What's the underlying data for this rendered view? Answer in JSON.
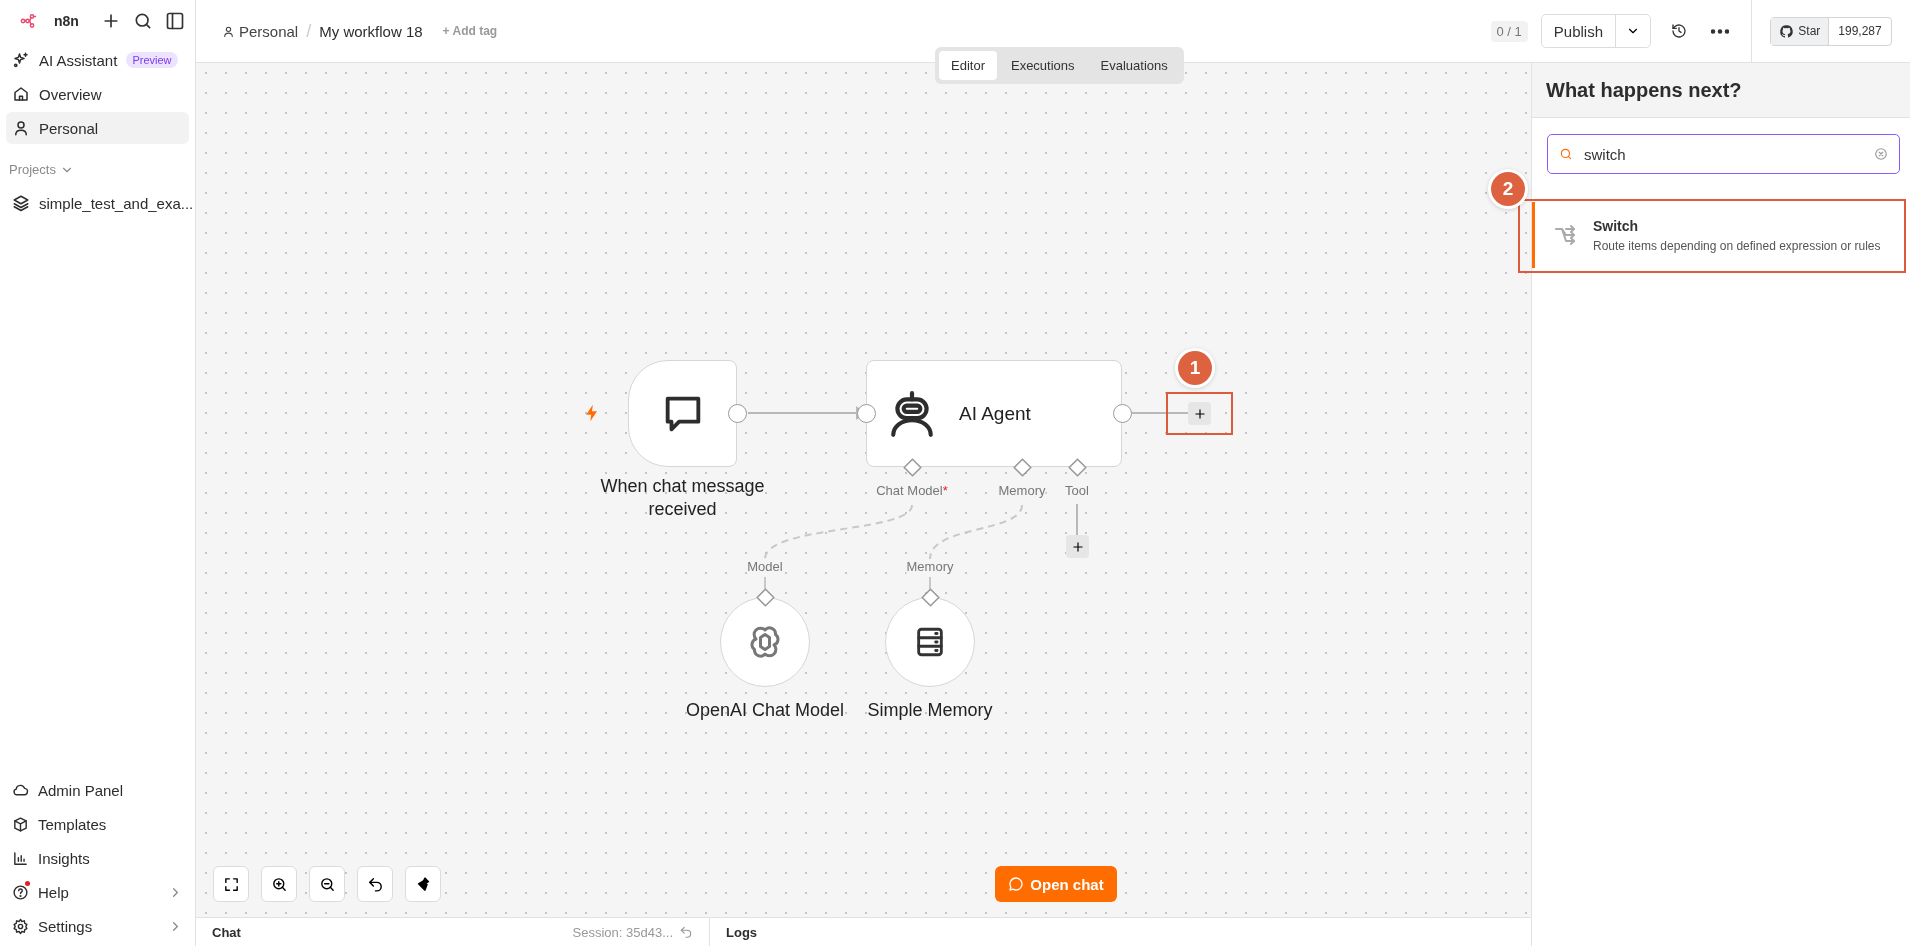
{
  "sidebar": {
    "logo": "n8n",
    "items": [
      {
        "label": "AI Assistant",
        "badge": "Preview",
        "selected": false
      },
      {
        "label": "Overview",
        "selected": false
      },
      {
        "label": "Personal",
        "selected": true
      }
    ],
    "projects_heading": "Projects",
    "projects": [
      {
        "label": "simple_test_and_exa..."
      }
    ],
    "bottom_items": [
      {
        "label": "Admin Panel",
        "notification": false,
        "submenu": false
      },
      {
        "label": "Templates",
        "notification": false,
        "submenu": false
      },
      {
        "label": "Insights",
        "notification": false,
        "submenu": false
      },
      {
        "label": "Help",
        "notification": true,
        "submenu": true
      },
      {
        "label": "Settings",
        "notification": false,
        "submenu": true
      }
    ]
  },
  "header": {
    "project": "Personal",
    "separator": "/",
    "workflow_name": "My workflow 18",
    "add_tag": "+ Add tag",
    "counter": "0 / 1",
    "publish": "Publish",
    "github_star": "Star",
    "github_count": "199,287"
  },
  "view_tabs": [
    {
      "label": "Editor",
      "selected": true
    },
    {
      "label": "Executions",
      "selected": false
    },
    {
      "label": "Evaluations",
      "selected": false
    }
  ],
  "canvas": {
    "nodes": [
      {
        "kind": "trigger",
        "name": "When chat message received"
      },
      {
        "kind": "agent",
        "name": "AI Agent",
        "inputs": [
          {
            "label": "Chat Model",
            "mark": "*"
          },
          {
            "label": "Memory"
          },
          {
            "label": "Tool"
          }
        ]
      },
      {
        "kind": "sub",
        "name": "OpenAI Chat Model",
        "port": "Model"
      },
      {
        "kind": "sub",
        "name": "Simple Memory",
        "port": "Memory"
      }
    ],
    "callout": "1",
    "open_chat": "Open chat"
  },
  "bottom_bar": {
    "chat": "Chat",
    "session": "Session: 35d43...",
    "logs": "Logs"
  },
  "node_panel": {
    "title": "What happens next?",
    "search": {
      "value": "switch"
    },
    "callout": "2",
    "results": [
      {
        "name": "Switch",
        "description": "Route items depending on defined expression or rules",
        "selected": true
      }
    ]
  }
}
